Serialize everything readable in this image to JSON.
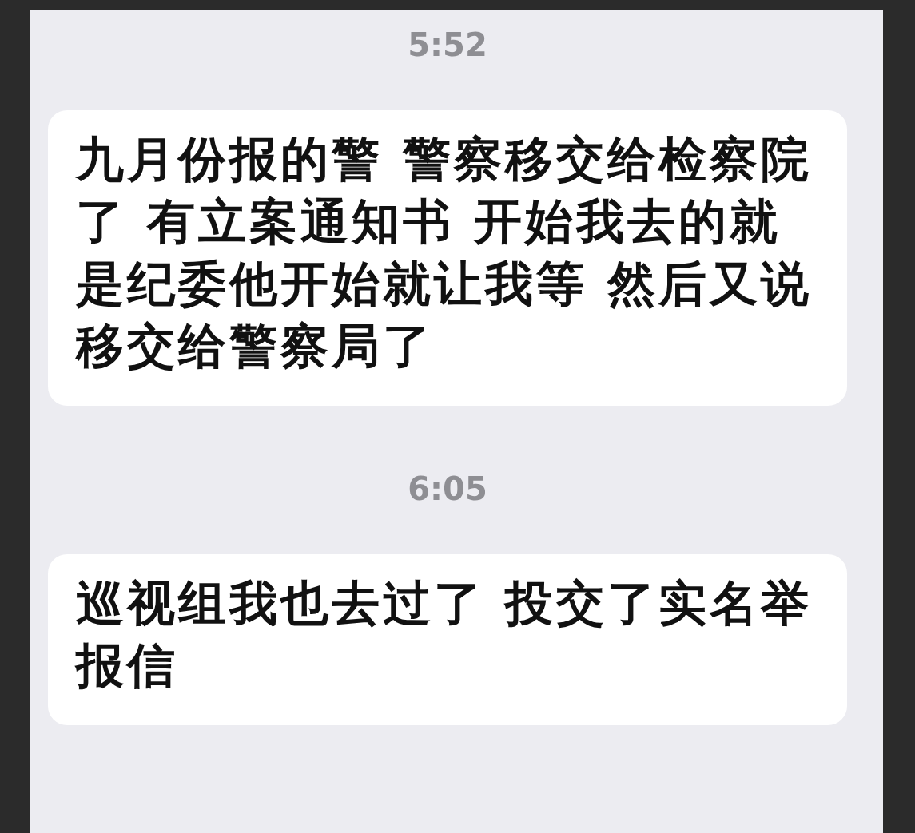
{
  "messages": [
    {
      "time": "5:52",
      "text": "九月份报的警 警察移交给检察院了 有立案通知书 开始我去的就是纪委他开始就让我等 然后又说移交给警察局了"
    },
    {
      "time": "6:05",
      "text": "巡视组我也去过了 投交了实名举报信"
    }
  ]
}
